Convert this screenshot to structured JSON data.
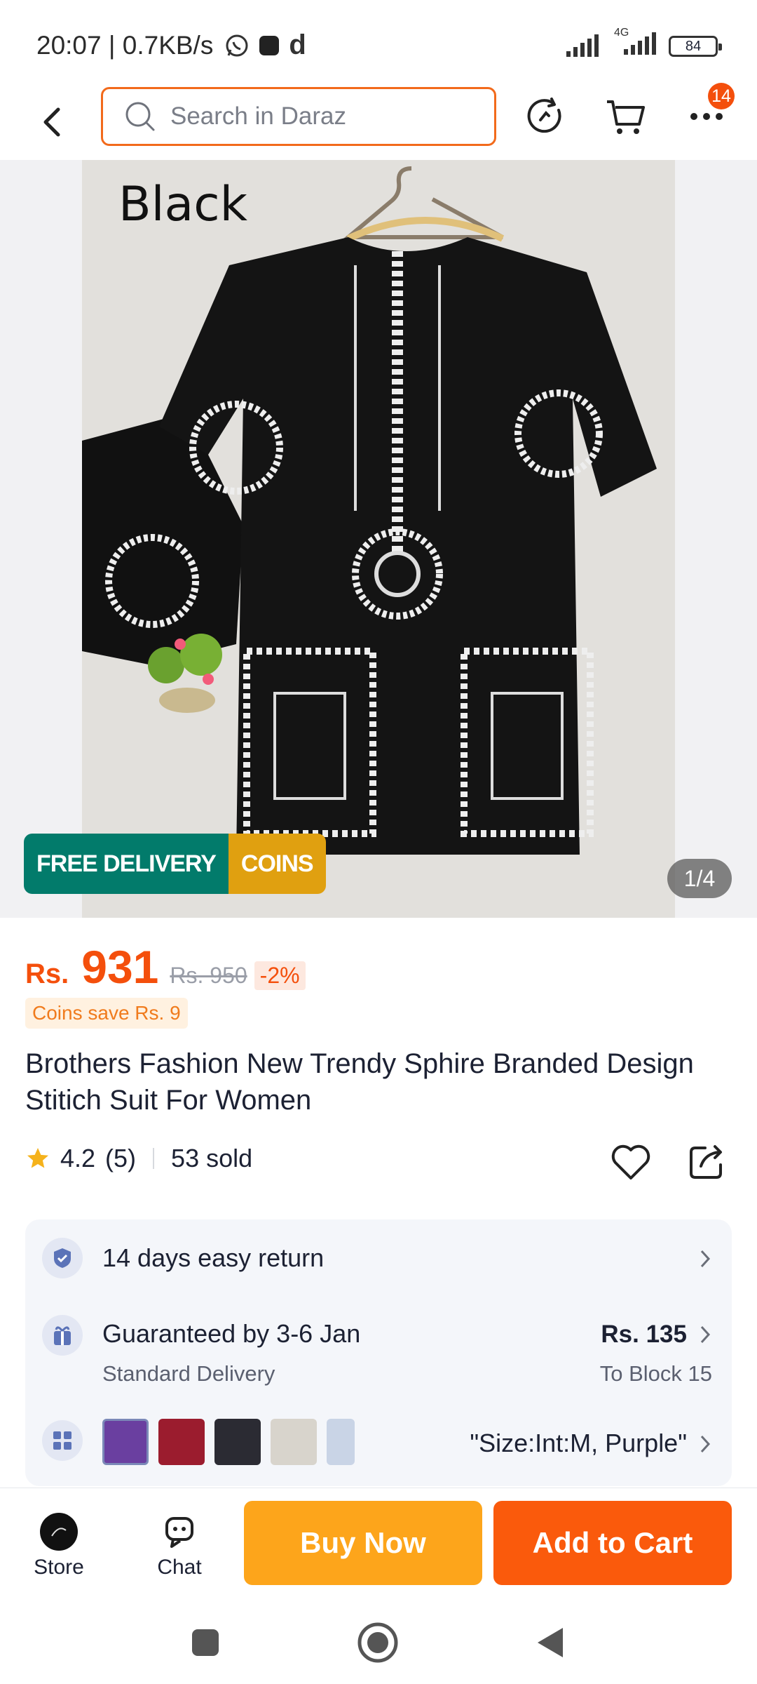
{
  "status_bar": {
    "time_speed": "20:07 | 0.7KB/s",
    "notif_letter": "d",
    "network_label": "4G",
    "battery": "84"
  },
  "header": {
    "search_placeholder": "Search in Daraz",
    "more_badge": "14"
  },
  "gallery": {
    "photo_label": "Black",
    "promo_free_delivery": "FREE DELIVERY",
    "promo_coins": "COINS",
    "page_indicator": "1/4"
  },
  "product": {
    "currency": "Rs.",
    "price": "931",
    "old_price": "Rs. 950",
    "discount": "-2%",
    "coins_save": "Coins save Rs. 9",
    "title": "Brothers Fashion New Trendy Sphire Branded Design Stitich Suit For Women",
    "rating": "4.2",
    "rating_count": "(5)",
    "sold": "53 sold"
  },
  "info": {
    "return_text": "14 days easy return",
    "delivery_text": "Guaranteed by 3-6 Jan",
    "delivery_sub": "Standard Delivery",
    "delivery_price": "Rs. 135",
    "delivery_dest": "To Block 15",
    "variant_text": "\"Size:Int:M, Purple\"",
    "swatch_colors": [
      "#6a3fa0",
      "#9b1c2e",
      "#2b2b33",
      "#d8d4cc",
      "#c9d4e6"
    ]
  },
  "bottom_bar": {
    "store_label": "Store",
    "chat_label": "Chat",
    "buy_now": "Buy Now",
    "add_to_cart": "Add to Cart"
  },
  "colors": {
    "accent": "#f44f0c",
    "buy_now": "#fda51b",
    "add_to_cart": "#fa5a0c",
    "free_delivery": "#027b6b",
    "coins": "#e0a010"
  }
}
